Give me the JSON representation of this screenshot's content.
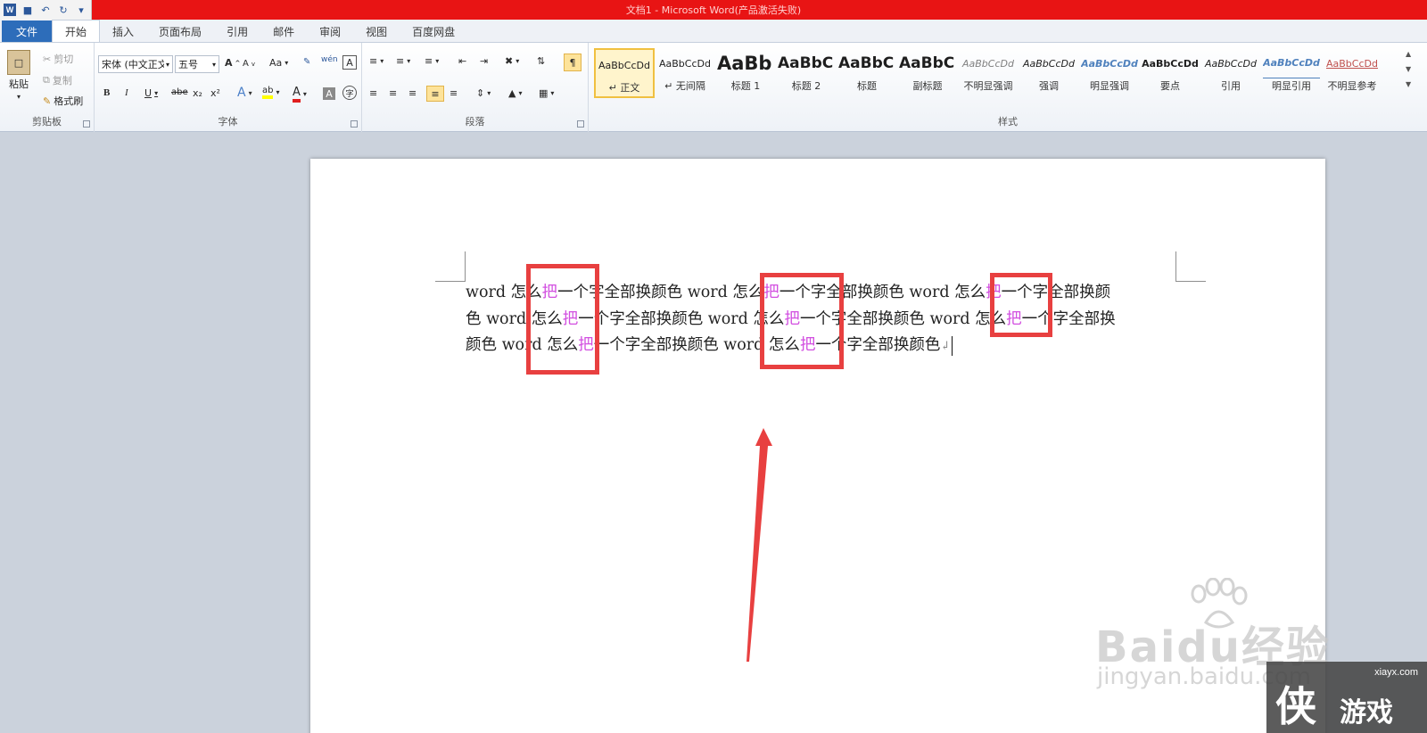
{
  "app": {
    "title": "文档1 - Microsoft Word(产品激活失败)",
    "logo": "W"
  },
  "quick_access": {
    "icons": [
      "word-app-icon",
      "save-icon",
      "undo-icon",
      "redo-icon",
      "customize-icon"
    ]
  },
  "tabs": [
    "文件",
    "开始",
    "插入",
    "页面布局",
    "引用",
    "邮件",
    "审阅",
    "视图",
    "百度网盘"
  ],
  "active_tab": "开始",
  "clipboard": {
    "paste": "粘贴",
    "cut": "剪切",
    "copy": "复制",
    "format_painter": "格式刷",
    "label": "剪贴板"
  },
  "font": {
    "name": "宋体 (中文正文)",
    "size": "五号",
    "label": "字体",
    "bold": "B",
    "italic": "I",
    "underline": "U",
    "strike": "abe",
    "subscript": "x₂",
    "superscript": "x²",
    "grow": "A",
    "shrink": "A",
    "case": "Aa",
    "wen": "wén",
    "font_color_glyph": "A",
    "shading_glyph": "A",
    "enclose_glyph": "字"
  },
  "paragraph": {
    "label": "段落"
  },
  "styles": {
    "label": "样式",
    "items": [
      {
        "sample": "AaBbCcDd",
        "name": "↵ 正文"
      },
      {
        "sample": "AaBbCcDd",
        "name": "↵ 无间隔"
      },
      {
        "sample": "AaBb",
        "name": "标题 1"
      },
      {
        "sample": "AaBbC",
        "name": "标题 2"
      },
      {
        "sample": "AaBbC",
        "name": "标题"
      },
      {
        "sample": "AaBbC",
        "name": "副标题"
      },
      {
        "sample": "AaBbCcDd",
        "name": "不明显强调"
      },
      {
        "sample": "AaBbCcDd",
        "name": "强调"
      },
      {
        "sample": "AaBbCcDd",
        "name": "明显强调"
      },
      {
        "sample": "AaBbCcDd",
        "name": "要点"
      },
      {
        "sample": "AaBbCcDd",
        "name": "引用"
      },
      {
        "sample": "AaBbCcDd",
        "name": "明显引用"
      },
      {
        "sample": "AaBbCcDd",
        "name": "不明显参考"
      }
    ]
  },
  "document": {
    "lines": [
      [
        "word 怎么",
        "把",
        "一个字全部换颜色 word 怎么",
        "把",
        "一个字全部换颜色 word 怎么",
        "把",
        "一个字全部换颜"
      ],
      [
        "色 word 怎么",
        "把",
        "一个字全部换颜色 word 怎么",
        "把",
        "一个字全部换颜色 word 怎么",
        "把",
        "一个字全部换"
      ],
      [
        "颜色 word 怎么",
        "把",
        "一个字全部换颜色 word 怎么",
        "把",
        "一个字全部换颜色"
      ]
    ],
    "paragraph_mark": "↲"
  },
  "colors": {
    "highlight_text": "#d24fe0",
    "annotation": "#e84040",
    "title_bar": "#e81414",
    "file_tab": "#2d6dba"
  },
  "watermarks": {
    "baidu": "Baidu经验",
    "baidu_url": "jingyan.baidu.com",
    "xiayx_url": "xiayx.com",
    "xiayx_big": "侠",
    "xiayx_small": "游戏"
  }
}
